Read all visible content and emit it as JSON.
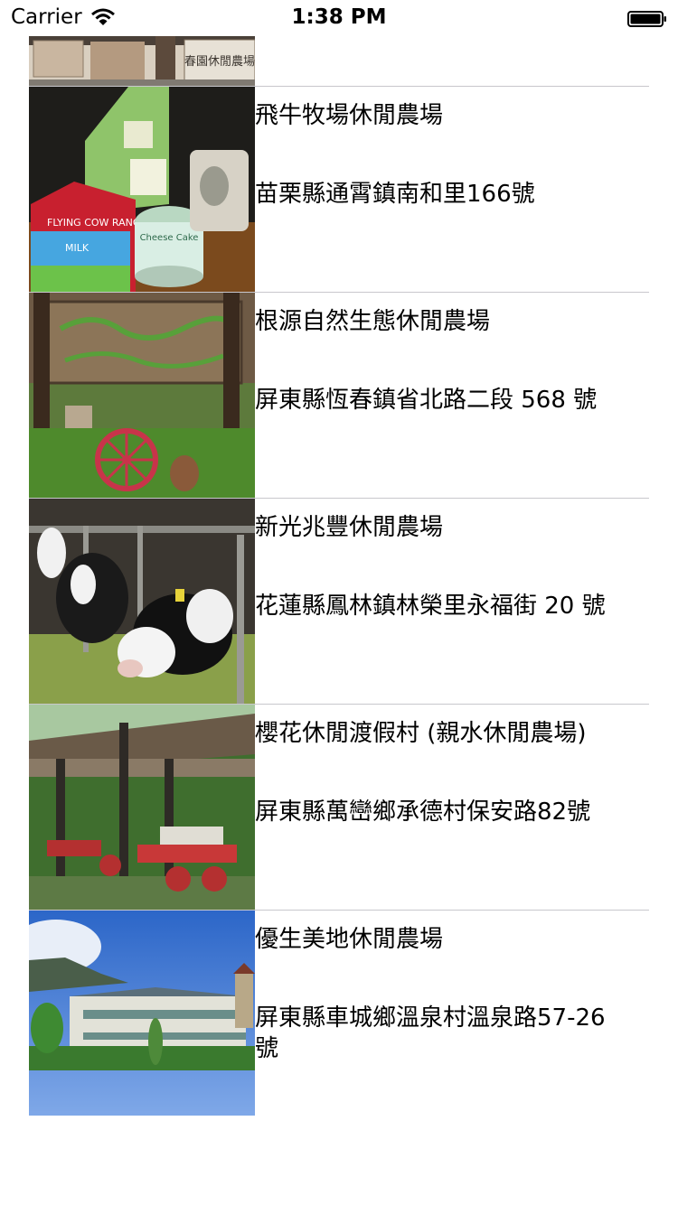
{
  "status_bar": {
    "carrier": "Carrier",
    "time": "1:38 PM"
  },
  "farms": [
    {
      "name": "",
      "address": "",
      "sign_text": "春園休閒農場"
    },
    {
      "name": "飛牛牧場休閒農場",
      "address": "苗栗縣通霄鎮南和里166號",
      "box_text": "FLYING COW RANCH",
      "box_text2": "MILK",
      "tin_text": "Cheese Cake"
    },
    {
      "name": "根源自然生態休閒農場",
      "address": "屏東縣恆春鎮省北路二段 568 號"
    },
    {
      "name": "新光兆豐休閒農場",
      "address": "花蓮縣鳳林鎮林榮里永福街 20 號"
    },
    {
      "name": "櫻花休閒渡假村 (親水休閒農場)",
      "address": "屏東縣萬巒鄉承德村保安路82號"
    },
    {
      "name": "優生美地休閒農場",
      "address": "屏東縣車城鄉溫泉村溫泉路57-26號"
    }
  ]
}
